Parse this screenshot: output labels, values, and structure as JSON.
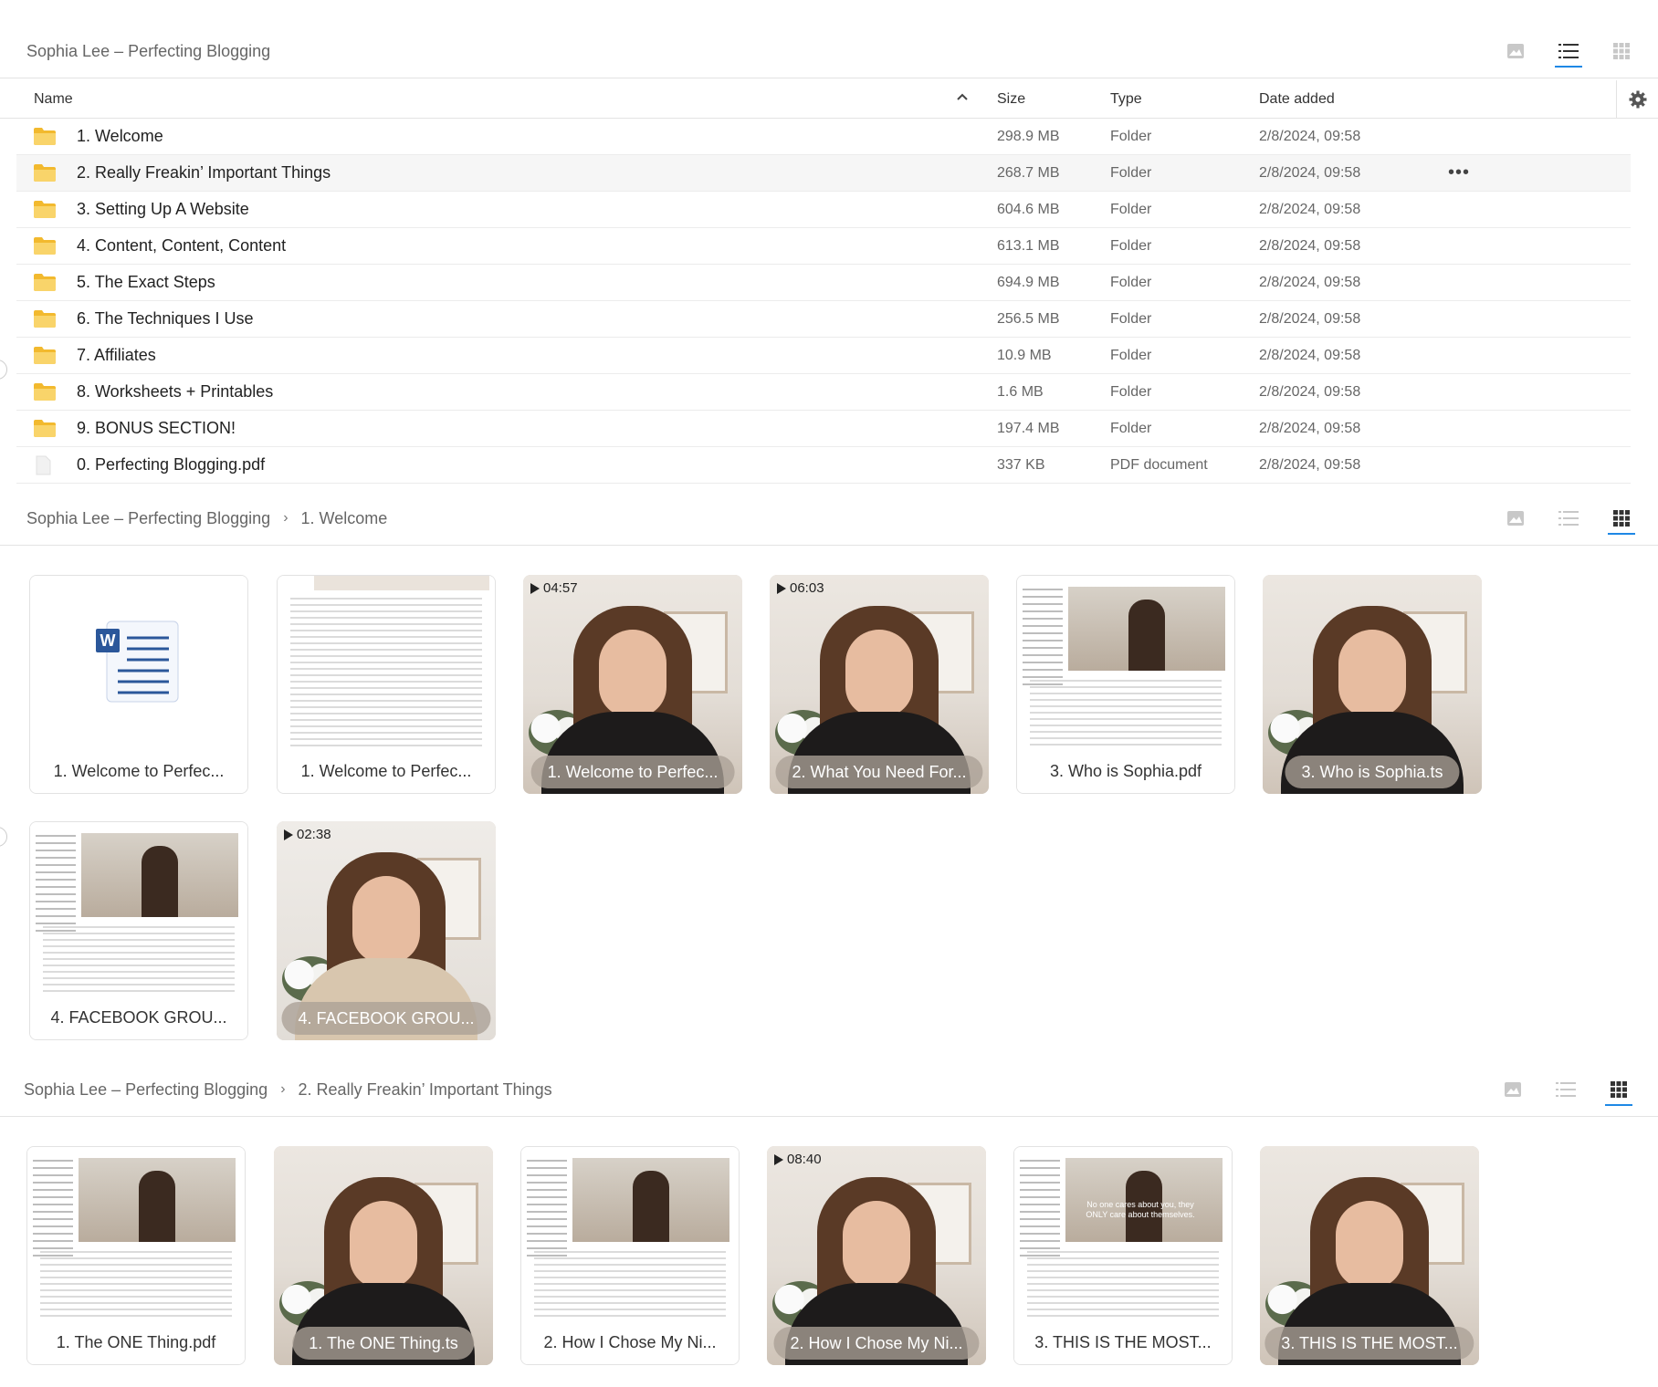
{
  "section1": {
    "breadcrumb": [
      "Sophia Lee – Perfecting Blogging"
    ],
    "columns": {
      "name": "Name",
      "size": "Size",
      "type": "Type",
      "date": "Date added"
    },
    "rows": [
      {
        "name": "1. Welcome",
        "size": "298.9 MB",
        "type": "Folder",
        "date": "2/8/2024, 09:58",
        "icon": "folder-icon"
      },
      {
        "name": "2. Really Freakin’ Important Things",
        "size": "268.7 MB",
        "type": "Folder",
        "date": "2/8/2024, 09:58",
        "icon": "folder-icon",
        "hover": true
      },
      {
        "name": "3. Setting Up A Website",
        "size": "604.6 MB",
        "type": "Folder",
        "date": "2/8/2024, 09:58",
        "icon": "folder-icon"
      },
      {
        "name": "4. Content, Content, Content",
        "size": "613.1 MB",
        "type": "Folder",
        "date": "2/8/2024, 09:58",
        "icon": "folder-icon"
      },
      {
        "name": "5. The Exact Steps",
        "size": "694.9 MB",
        "type": "Folder",
        "date": "2/8/2024, 09:58",
        "icon": "folder-icon"
      },
      {
        "name": "6. The Techniques I Use",
        "size": "256.5 MB",
        "type": "Folder",
        "date": "2/8/2024, 09:58",
        "icon": "folder-icon"
      },
      {
        "name": "7. Affiliates",
        "size": "10.9 MB",
        "type": "Folder",
        "date": "2/8/2024, 09:58",
        "icon": "folder-icon"
      },
      {
        "name": "8. Worksheets + Printables",
        "size": "1.6 MB",
        "type": "Folder",
        "date": "2/8/2024, 09:58",
        "icon": "folder-icon"
      },
      {
        "name": "9. BONUS SECTION!",
        "size": "197.4 MB",
        "type": "Folder",
        "date": "2/8/2024, 09:58",
        "icon": "folder-icon"
      },
      {
        "name": "0. Perfecting Blogging.pdf",
        "size": "337 KB",
        "type": "PDF document",
        "date": "2/8/2024, 09:58",
        "icon": "pdf-file-icon"
      }
    ]
  },
  "section2": {
    "breadcrumb": [
      "Sophia Lee – Perfecting Blogging",
      "1. Welcome"
    ],
    "tiles": [
      {
        "label": "1. Welcome to Perfec...",
        "kind": "word"
      },
      {
        "label": "1. Welcome to Perfec...",
        "kind": "doc"
      },
      {
        "label": "1. Welcome to Perfec...",
        "kind": "video",
        "duration": "04:57"
      },
      {
        "label": "2. What You Need For...",
        "kind": "video",
        "duration": "06:03"
      },
      {
        "label": "3. Who is Sophia.pdf",
        "kind": "docshot"
      },
      {
        "label": "3. Who is Sophia.ts",
        "kind": "video",
        "duration": ""
      },
      {
        "label": "4. FACEBOOK GROU...",
        "kind": "docshot"
      },
      {
        "label": "4. FACEBOOK GROU...",
        "kind": "video-beige",
        "duration": "02:38"
      }
    ]
  },
  "section3": {
    "breadcrumb": [
      "Sophia Lee – Perfecting Blogging",
      "2. Really Freakin’ Important Things"
    ],
    "tiles": [
      {
        "label": "1. The ONE Thing.pdf",
        "kind": "docshot"
      },
      {
        "label": "1. The ONE Thing.ts",
        "kind": "video",
        "duration": ""
      },
      {
        "label": "2. How I Chose My Ni...",
        "kind": "docshot"
      },
      {
        "label": "2. How I Chose My Ni...",
        "kind": "video",
        "duration": "08:40"
      },
      {
        "label": "3. THIS IS THE MOST...",
        "kind": "docshot",
        "caption": "No one cares about you, they ONLY care about themselves."
      },
      {
        "label": "3. THIS IS THE MOST...",
        "kind": "video",
        "duration": ""
      }
    ]
  },
  "colors": {
    "accent": "#1e88e5",
    "folder": "#f5c84c"
  }
}
